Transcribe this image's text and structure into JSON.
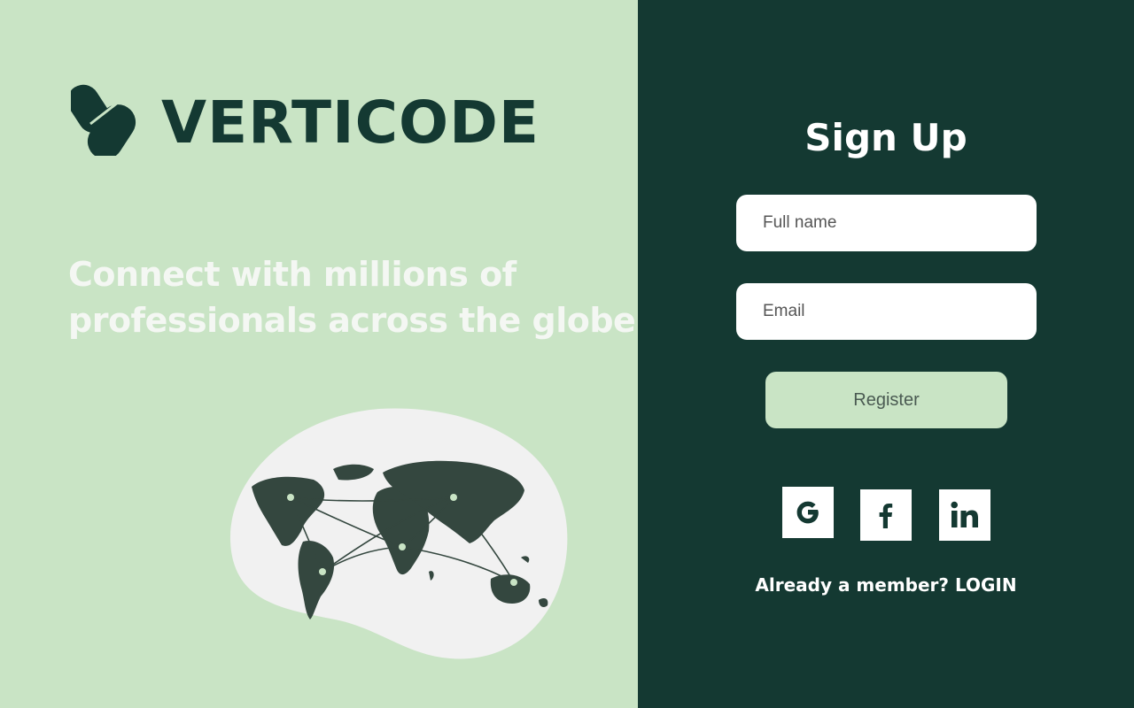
{
  "brand": {
    "name": "VERTICODE"
  },
  "hero": {
    "line1": "Connect with millions of",
    "line2": "professionals across the globe"
  },
  "signup": {
    "title": "Sign Up",
    "fullname_placeholder": "Full name",
    "email_placeholder": "Email",
    "register_label": "Register",
    "already_member_text": "Already a member? ",
    "login_label": "LOGIN"
  },
  "social": [
    {
      "icon": "google-icon"
    },
    {
      "icon": "facebook-icon"
    },
    {
      "icon": "linkedin-icon"
    }
  ],
  "colors": {
    "left_background": "#c9e4c5",
    "right_background": "#143932",
    "brand_dark": "#143932",
    "button_fill": "#c9e4c5"
  }
}
